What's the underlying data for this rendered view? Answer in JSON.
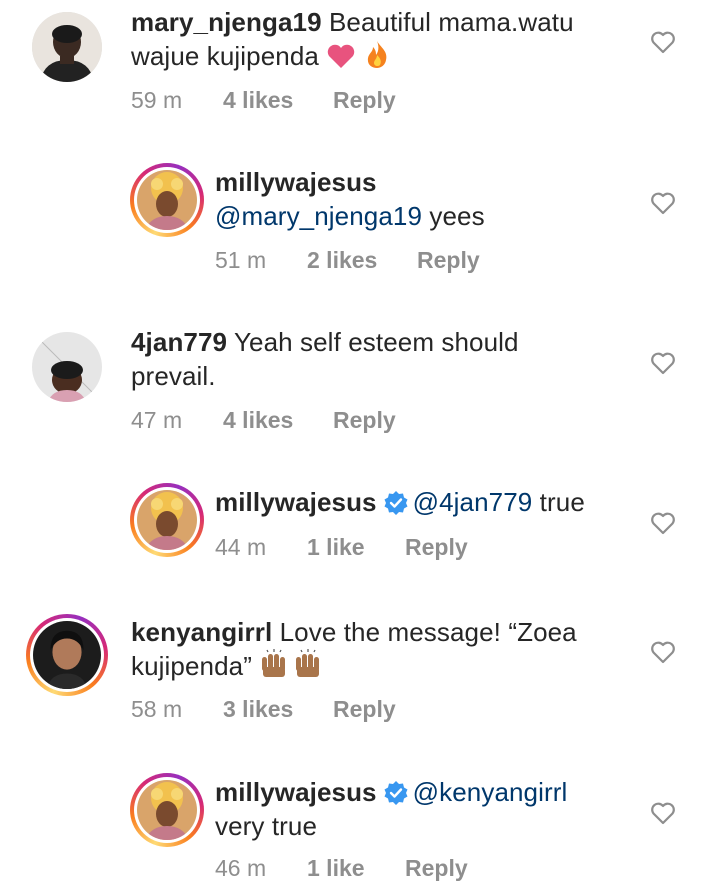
{
  "comments": [
    {
      "user": "mary_njenga19",
      "mention": "",
      "text": "Beautiful mama.watu",
      "text2": "wajue kujipenda",
      "time": "59 m",
      "likes": "4 likes",
      "reply": "Reply",
      "verified": false
    },
    {
      "user": "millywajesus",
      "mention": "@mary_njenga19",
      "text": " yees",
      "text2": "",
      "time": "51 m",
      "likes": "2 likes",
      "reply": "Reply",
      "verified": false
    },
    {
      "user": "4jan779",
      "mention": "",
      "text": "Yeah self esteem should",
      "text2": "prevail.",
      "time": "47 m",
      "likes": "4 likes",
      "reply": "Reply",
      "verified": false
    },
    {
      "user": "millywajesus",
      "mention": "@4jan779",
      "text": " true",
      "text2": "",
      "time": "44 m",
      "likes": "1 like",
      "reply": "Reply",
      "verified": true
    },
    {
      "user": "kenyangirrl",
      "mention": "",
      "text": "Love the message! “Zoea",
      "text2": "kujipenda”",
      "time": "58 m",
      "likes": "3 likes",
      "reply": "Reply",
      "verified": false
    },
    {
      "user": "millywajesus",
      "mention": "@kenyangirrl",
      "text": "",
      "text2": "very true",
      "time": "46 m",
      "likes": "1 like",
      "reply": "Reply",
      "verified": true
    }
  ],
  "icons": {
    "like": "heart-outline-icon",
    "verified": "verified-badge-icon",
    "emoji_heart": "pink-heart-emoji",
    "emoji_fire": "fire-emoji",
    "emoji_hands": "raising-hands-emoji"
  },
  "colors": {
    "mention": "#00376b",
    "meta": "#8e8e8e",
    "verified": "#3897f0"
  }
}
